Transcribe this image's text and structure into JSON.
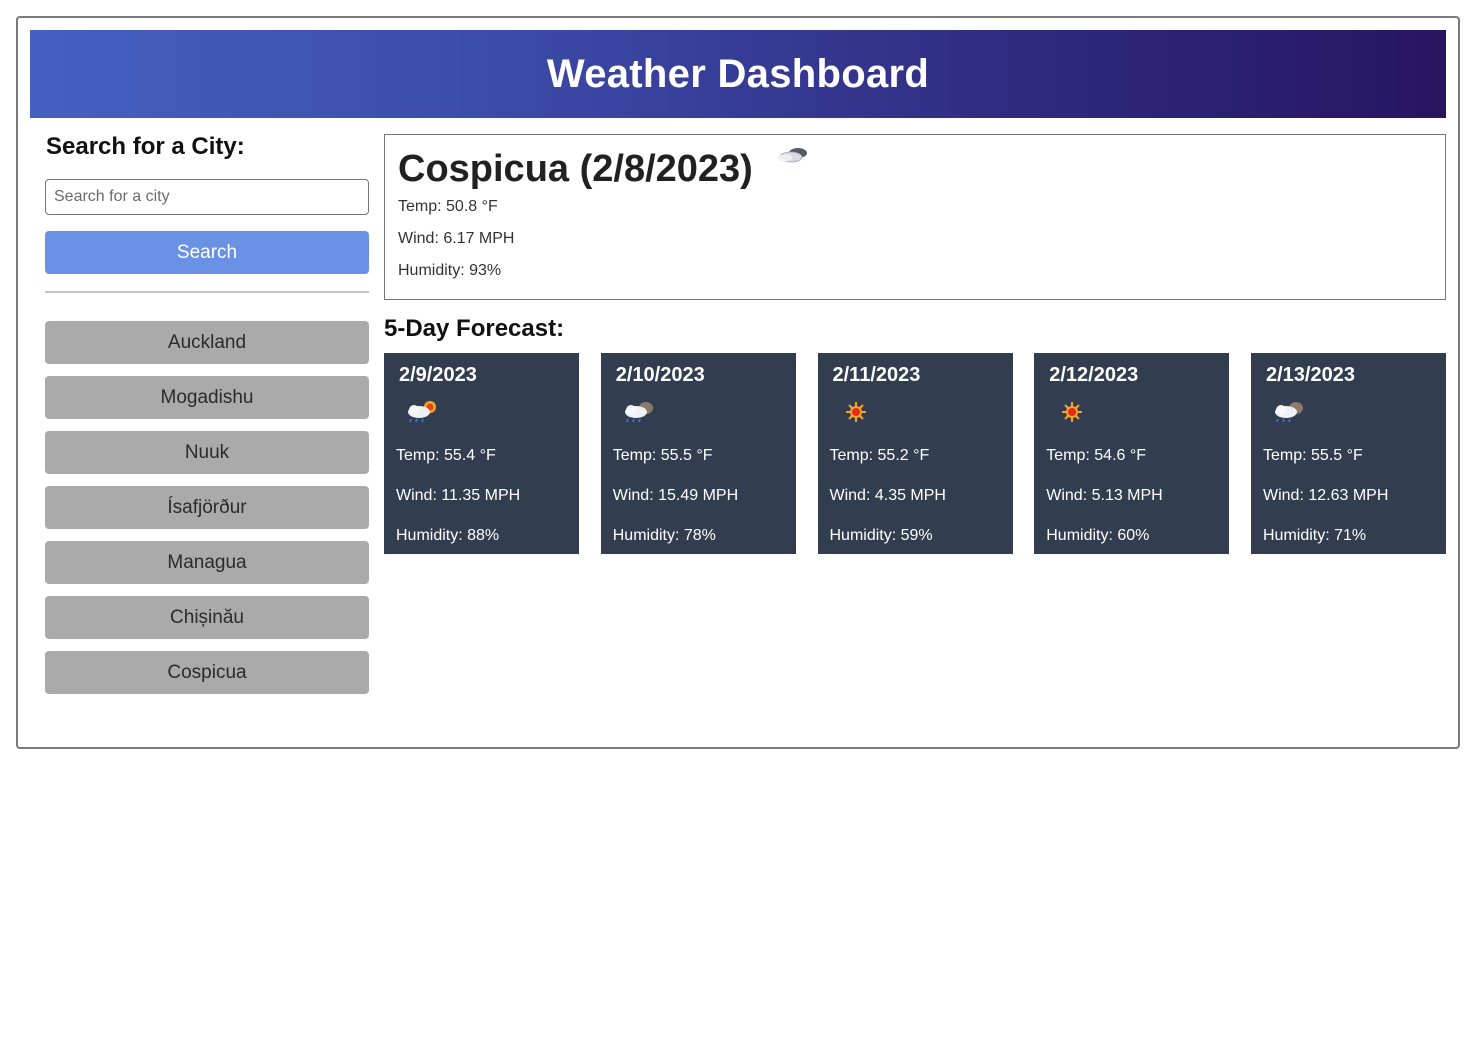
{
  "header": {
    "title": "Weather Dashboard"
  },
  "sidebar": {
    "heading": "Search for a City:",
    "search_placeholder": "Search for a city",
    "search_value": "",
    "search_button": "Search",
    "history": [
      "Auckland",
      "Mogadishu",
      "Nuuk",
      "Ísafjörður",
      "Managua",
      "Chișinău",
      "Cospicua"
    ]
  },
  "current": {
    "title": "Cospicua (2/8/2023)",
    "icon": "cloud-icon",
    "temp": "Temp: 50.8 °F",
    "wind": "Wind: 6.17 MPH",
    "humidity": "Humidity: 93%"
  },
  "forecast": {
    "heading": "5-Day Forecast:",
    "days": [
      {
        "date": "2/9/2023",
        "icon": "rain-sun-icon",
        "temp": "Temp: 55.4 °F",
        "wind": "Wind: 11.35 MPH",
        "humidity": "Humidity: 88%"
      },
      {
        "date": "2/10/2023",
        "icon": "rain-cloud-icon",
        "temp": "Temp: 55.5 °F",
        "wind": "Wind: 15.49 MPH",
        "humidity": "Humidity: 78%"
      },
      {
        "date": "2/11/2023",
        "icon": "sun-icon",
        "temp": "Temp: 55.2 °F",
        "wind": "Wind: 4.35 MPH",
        "humidity": "Humidity: 59%"
      },
      {
        "date": "2/12/2023",
        "icon": "sun-icon",
        "temp": "Temp: 54.6 °F",
        "wind": "Wind: 5.13 MPH",
        "humidity": "Humidity: 60%"
      },
      {
        "date": "2/13/2023",
        "icon": "rain-cloud-icon",
        "temp": "Temp: 55.5 °F",
        "wind": "Wind: 12.63 MPH",
        "humidity": "Humidity: 71%"
      }
    ]
  },
  "colors": {
    "header_gradient_start": "#4660c0",
    "header_gradient_end": "#281560",
    "search_button": "#6a92e4",
    "history_button": "#aaaaaa",
    "forecast_card": "#333d50"
  }
}
